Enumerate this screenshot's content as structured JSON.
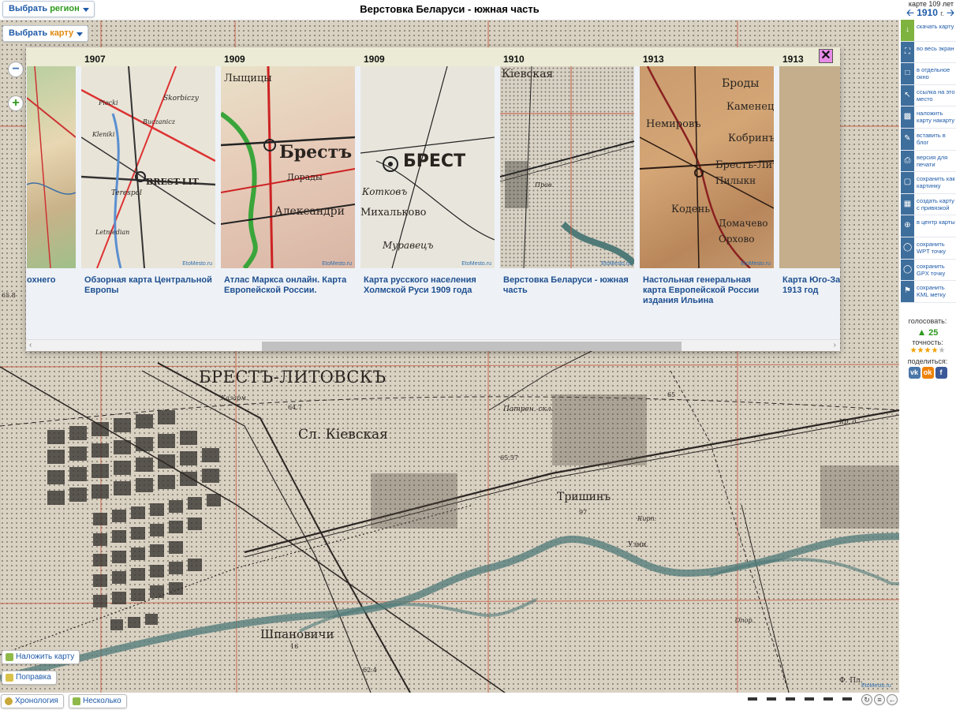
{
  "header": {
    "title": "Верстовка Беларуси - южная часть",
    "select_region": {
      "prefix": "Выбрать",
      "accent": "регион"
    },
    "select_map": {
      "prefix": "Выбрать",
      "accent": "карту"
    }
  },
  "year_box": {
    "age_text": "карте 109 лет",
    "year": "1910",
    "unit": "г."
  },
  "tools": [
    {
      "icon": "download-icon",
      "label": "скачать карту"
    },
    {
      "icon": "fullscreen-icon",
      "label": "во весь экран"
    },
    {
      "icon": "new-window-icon",
      "label": "в отдельное окно"
    },
    {
      "icon": "cursor-icon",
      "label": "ссылка на это место"
    },
    {
      "icon": "overlay-icon",
      "label": "наложить карту накарту"
    },
    {
      "icon": "pencil-icon",
      "label": "вставить в блог"
    },
    {
      "icon": "printer-icon",
      "label": "версия для печати"
    },
    {
      "icon": "save-image-icon",
      "label": "сохранить как картинку"
    },
    {
      "icon": "grid-icon",
      "label": "создать карту с привязкой"
    },
    {
      "icon": "crosshair-icon",
      "label": "в центр карты"
    },
    {
      "icon": "wpt-icon",
      "label": "сохранить WPT точку"
    },
    {
      "icon": "gpx-icon",
      "label": "сохранить GPX точку"
    },
    {
      "icon": "kml-icon",
      "label": "сохранить KML метку"
    }
  ],
  "vote": {
    "vote_label": "голосовать:",
    "count": "25",
    "accuracy_label": "точность:",
    "stars_total": 5,
    "stars_filled": 4,
    "share_label": "поделиться:",
    "share_icons": [
      "vk-icon",
      "odnoklassniki-icon",
      "facebook-icon"
    ]
  },
  "timeline": {
    "cards": [
      {
        "year": "",
        "caption": "охнего"
      },
      {
        "year": "1907",
        "caption": "Обзорная карта Центральной Европы"
      },
      {
        "year": "1909",
        "caption": "Атлас Маркса онлайн. Карта Европейской России."
      },
      {
        "year": "1909",
        "caption": "Карта русского населения Холмской Руси 1909 года"
      },
      {
        "year": "1910",
        "caption": "Верстовка Беларуси - южная часть"
      },
      {
        "year": "1913",
        "caption": "Настольная генеральная карта Европейской России издания Ильина"
      },
      {
        "year": "1913",
        "caption": "Карта Юго-За 1913 год"
      }
    ],
    "watermark": "EtoMesto.ru",
    "thumb_labels": {
      "c1": "BREST-LIT",
      "c2a": "Брестъ",
      "c2b": "Лыщицы",
      "c2c": "Александри",
      "c2d": "Дорады",
      "c3a": "БРЕСТ",
      "c3b": "Котковъ",
      "c3c": "Михальково",
      "c3d": "Муравецъ",
      "c4": "Кiевская",
      "c4b": "Прав.",
      "c5a": "Брестъ-Лит",
      "c5b": "Немировъ",
      "c5c": "Кобринъ",
      "c5d": "Каменецъ",
      "c5e": "Кодень",
      "c5f": "Домачево",
      "c5g": "Орхово",
      "c5h": "Броды",
      "c5i": "Пилыкн",
      "c1b": "Skorbiczy",
      "c1c": "Terespol",
      "c1d": "Letniedian",
      "c1e": "Kleniki",
      "c1f": "Piecki",
      "c1g": "Buczanicz"
    }
  },
  "map_labels": {
    "city": "БРЕСТЪ-ЛИТОВСКЪ",
    "kievskaya": "Сл. Кiевская",
    "trishin": "Тришинъ",
    "shpanovichi": "Шпановичи",
    "patr": "Патрен. скл.",
    "kazarmy": "Казарм.",
    "num1": "64.7",
    "num2": "65.57",
    "num3": "65",
    "num4": "62.4",
    "num5": "97",
    "num6": "16",
    "num7": "65.8",
    "num8": "Кирп.",
    "num9": "Узни.",
    "num10": "Опор.",
    "num11": "Ф. Пл.",
    "num12": "Кр. д."
  },
  "bottom": {
    "overlay_map": "Наложить карту",
    "correction": "Поправка",
    "chronology": "Хронология",
    "several": "Несколько",
    "watermark": "EtoMesto.ru"
  },
  "colors": {
    "accent_blue": "#1e5aa8",
    "accent_green": "#2d9a1e",
    "accent_orange": "#e08a10",
    "close_pink": "#e68ce6",
    "tool_strip": "#3e6e9c",
    "map_paper": "#d9d2c3",
    "river": "#4f7a78"
  }
}
